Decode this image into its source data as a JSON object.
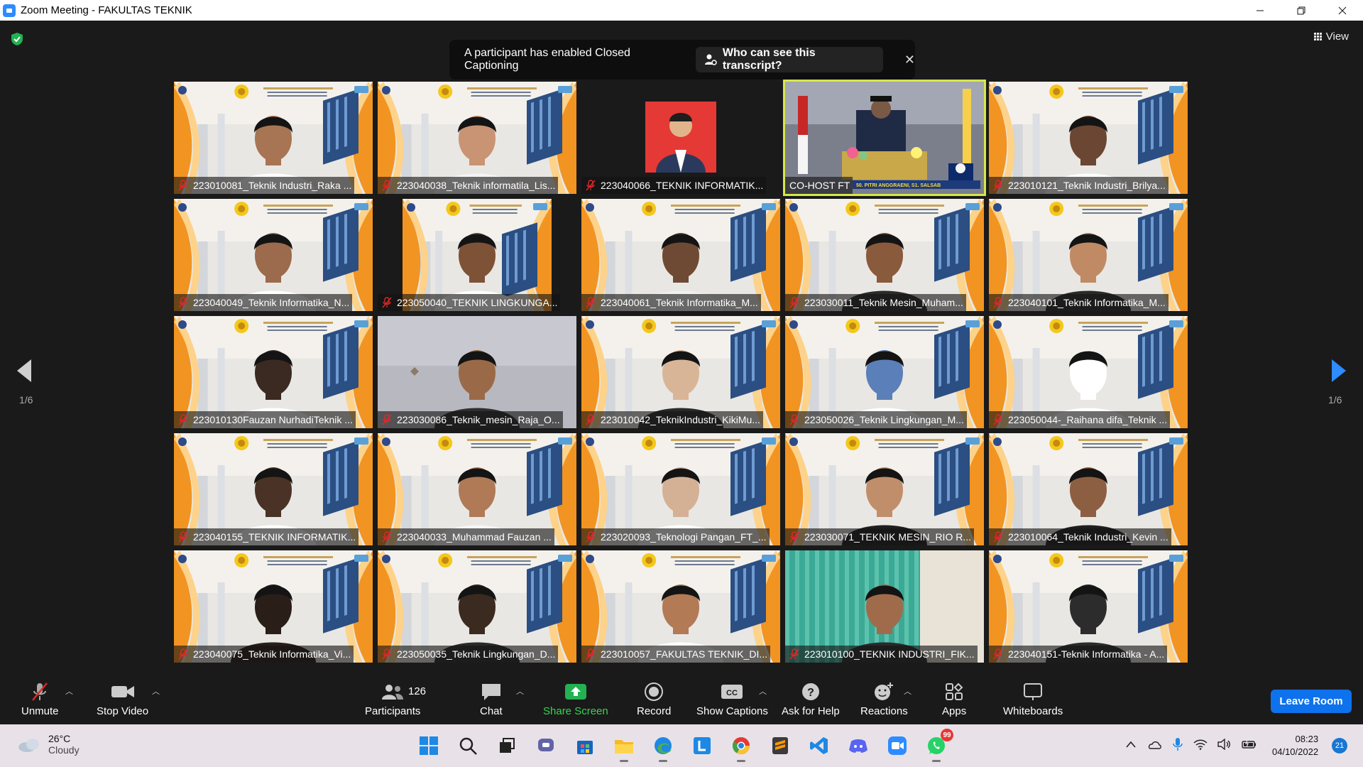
{
  "window": {
    "title": "Zoom Meeting - FAKULTAS TEKNIK",
    "controls": [
      "minimize",
      "restore",
      "close"
    ]
  },
  "meeting": {
    "view_label": "View",
    "cc_banner": {
      "message": "A participant has enabled Closed Captioning",
      "button": "Who can see this transcript?"
    },
    "page_left": "1/6",
    "page_right": "1/6",
    "tiles": [
      {
        "name": "223010081_Teknik Industri_Raka ...",
        "bg": "banner",
        "skin": "#a77553",
        "shirt": "#fff"
      },
      {
        "name": "223040038_Teknik informatila_Lis...",
        "bg": "banner",
        "skin": "#c99473",
        "shirt": "#f4f4f4"
      },
      {
        "name": "223040066_TEKNIK INFORMATIK...",
        "bg": "photo"
      },
      {
        "name": "CO-HOST FT",
        "bg": "ceremony",
        "active": true,
        "caption": "50. PITRI ANGGRAENI, S1. SALSAB"
      },
      {
        "name": "223010121_Teknik Industri_Brilya...",
        "bg": "banner",
        "skin": "#6b4632",
        "shirt": "#fff"
      },
      {
        "name": "223040049_Teknik Informatika_N...",
        "bg": "banner",
        "skin": "#9c6a4c",
        "shirt": "#fff"
      },
      {
        "name": "223050040_TEKNIK LINGKUNGA...",
        "bg": "banner-narrow",
        "skin": "#7d5236",
        "shirt": "#fff"
      },
      {
        "name": "223040061_Teknik Informatika_M...",
        "bg": "banner",
        "skin": "#6e4a34",
        "shirt": "#f0f0f0"
      },
      {
        "name": "223030011_Teknik Mesin_Muham...",
        "bg": "banner",
        "skin": "#8a5a3c",
        "shirt": "#2b2b2b"
      },
      {
        "name": "223040101_Teknik Informatika_M...",
        "bg": "banner",
        "skin": "#c08a64",
        "shirt": "#2a2a2a"
      },
      {
        "name": "223010130Fauzan NurhadiTeknik ...",
        "bg": "banner",
        "skin": "#3a2a22",
        "shirt": "#ffffff"
      },
      {
        "name": "223030086_Teknik_mesin_Raja_O...",
        "bg": "room",
        "skin": "#9a6a48",
        "shirt": "#2f2f2f"
      },
      {
        "name": "223010042_TeknikIndustri_KikiMu...",
        "bg": "banner",
        "skin": "#d9b597",
        "shirt": "#2a2a2a"
      },
      {
        "name": "223050026_Teknik Lingkungan_M...",
        "bg": "banner",
        "skin": "#5b7fb8",
        "shirt": "#ffffff"
      },
      {
        "name": "223050044-_Raihana difa_Teknik ...",
        "bg": "banner",
        "skin": "#ffffff",
        "shirt": "#ffffff"
      },
      {
        "name": "223040155_TEKNIK INFORMATIK...",
        "bg": "banner",
        "skin": "#4a3326",
        "shirt": "#fff"
      },
      {
        "name": "223040033_Muhammad Fauzan ...",
        "bg": "banner",
        "skin": "#b07a57",
        "shirt": "#f6f6f6"
      },
      {
        "name": "223020093_Teknologi Pangan_FT_...",
        "bg": "banner",
        "skin": "#d4b095",
        "shirt": "#ffffff"
      },
      {
        "name": "223030071_TEKNIK MESIN_RIO R...",
        "bg": "banner",
        "skin": "#c18e6b",
        "shirt": "#1e1e1e"
      },
      {
        "name": "223010064_Teknik Industri_Kevin ...",
        "bg": "banner",
        "skin": "#8d5f42",
        "shirt": "#1e1e1e"
      },
      {
        "name": "223040075_Teknik Informatika_Vi...",
        "bg": "banner",
        "skin": "#2a1e18",
        "shirt": "#2a1e18"
      },
      {
        "name": "223050035_Teknik Lingkungan_D...",
        "bg": "banner",
        "skin": "#3a2a20",
        "shirt": "#2a2a2a"
      },
      {
        "name": "223010057_FAKULTAS TEKNIK_DI...",
        "bg": "banner",
        "skin": "#b27a55",
        "shirt": "#fff"
      },
      {
        "name": "223010100_TEKNIK INDUSTRI_FIK...",
        "bg": "curtain",
        "skin": "#a06b4b",
        "shirt": "#2a2a2a"
      },
      {
        "name": "223040151-Teknik Informatika - A...",
        "bg": "banner",
        "skin": "#2c2c2c",
        "shirt": "#2c2c2c"
      }
    ]
  },
  "toolbar": {
    "unmute": "Unmute",
    "stop_video": "Stop Video",
    "participants": "Participants",
    "participants_count": "126",
    "chat": "Chat",
    "share_screen": "Share Screen",
    "record": "Record",
    "show_captions": "Show Captions",
    "ask_for_help": "Ask for Help",
    "reactions": "Reactions",
    "apps": "Apps",
    "whiteboards": "Whiteboards",
    "leave": "Leave Room"
  },
  "taskbar": {
    "weather_temp": "26°C",
    "weather_cond": "Cloudy",
    "whatsapp_badge": "99",
    "time": "08:23",
    "date": "04/10/2022",
    "notifications": "21"
  },
  "colors": {
    "accent_blue": "#0e72ed",
    "share_green": "#39d353",
    "active_speaker": "#d6e74a",
    "muted_red": "#e02828"
  }
}
